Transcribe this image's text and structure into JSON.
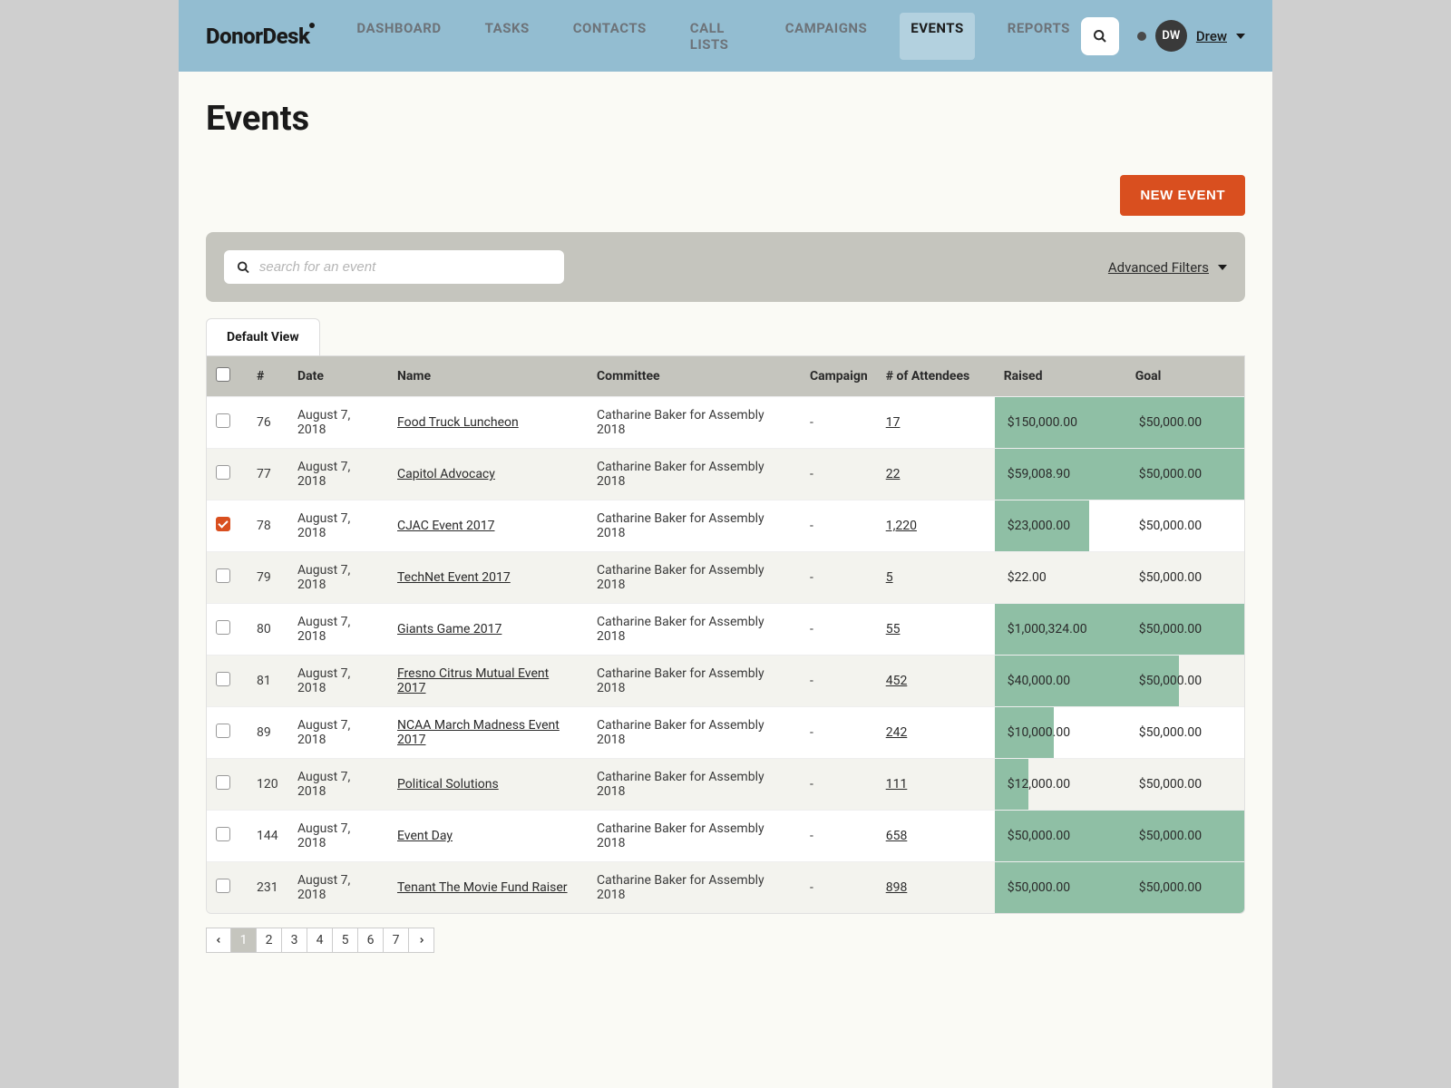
{
  "brand": "DonorDesk",
  "nav": {
    "items": [
      "DASHBOARD",
      "TASKS",
      "CONTACTS",
      "CALL LISTS",
      "CAMPAIGNS",
      "EVENTS",
      "REPORTS"
    ],
    "active": 5
  },
  "user": {
    "initials": "DW",
    "name": "Drew"
  },
  "page": {
    "title": "Events"
  },
  "buttons": {
    "new_event": "NEW EVENT"
  },
  "search": {
    "placeholder": "search for an event"
  },
  "filters": {
    "advanced_label": "Advanced Filters"
  },
  "tabs": {
    "default": "Default View"
  },
  "table": {
    "headers": {
      "num": "#",
      "date": "Date",
      "name": "Name",
      "committee": "Committee",
      "campaign": "Campaign",
      "attendees": "# of Attendees",
      "raised": "Raised",
      "goal": "Goal"
    },
    "rows": [
      {
        "checked": false,
        "num": "76",
        "date": "August 7, 2018",
        "name": "Food Truck Luncheon",
        "committee": "Catharine Baker for Assembly 2018",
        "campaign": "-",
        "attendees": "17",
        "raised": "$150,000.00",
        "raised_pct": 100,
        "goal": "$50,000.00",
        "goal_pct": 100
      },
      {
        "checked": false,
        "num": "77",
        "date": "August 7, 2018",
        "name": "Capitol Advocacy",
        "committee": "Catharine Baker for Assembly 2018",
        "campaign": "-",
        "attendees": "22",
        "raised": "$59,008.90",
        "raised_pct": 100,
        "goal": "$50,000.00",
        "goal_pct": 100
      },
      {
        "checked": true,
        "num": "78",
        "date": "August 7, 2018",
        "name": "CJAC Event 2017",
        "committee": "Catharine Baker for Assembly 2018",
        "campaign": "-",
        "attendees": "1,220",
        "raised": "$23,000.00",
        "raised_pct": 72,
        "goal": "$50,000.00",
        "goal_pct": 0
      },
      {
        "checked": false,
        "num": "79",
        "date": "August 7, 2018",
        "name": "TechNet Event 2017",
        "committee": "Catharine Baker for Assembly 2018",
        "campaign": "-",
        "attendees": "5",
        "raised": "$22.00",
        "raised_pct": 0,
        "goal": "$50,000.00",
        "goal_pct": 0
      },
      {
        "checked": false,
        "num": "80",
        "date": "August 7, 2018",
        "name": "Giants Game 2017",
        "committee": "Catharine Baker for Assembly 2018",
        "campaign": "-",
        "attendees": "55",
        "raised": "$1,000,324.00",
        "raised_pct": 100,
        "goal": "$50,000.00",
        "goal_pct": 100
      },
      {
        "checked": false,
        "num": "81",
        "date": "August 7, 2018",
        "name": "Fresno Citrus Mutual Event 2017",
        "committee": "Catharine Baker for Assembly 2018",
        "campaign": "-",
        "attendees": "452",
        "raised": "$40,000.00",
        "raised_pct": 100,
        "goal": "$50,000.00",
        "goal_pct": 45
      },
      {
        "checked": false,
        "num": "89",
        "date": "August 7, 2018",
        "name": "NCAA March Madness Event 2017",
        "committee": "Catharine Baker for Assembly 2018",
        "campaign": "-",
        "attendees": "242",
        "raised": "$10,000.00",
        "raised_pct": 45,
        "goal": "$50,000.00",
        "goal_pct": 0
      },
      {
        "checked": false,
        "num": "120",
        "date": "August 7, 2018",
        "name": "Political Solutions",
        "committee": "Catharine Baker for Assembly 2018",
        "campaign": "-",
        "attendees": "111",
        "raised": "$12,000.00",
        "raised_pct": 26,
        "goal": "$50,000.00",
        "goal_pct": 0
      },
      {
        "checked": false,
        "num": "144",
        "date": "August 7, 2018",
        "name": "Event Day",
        "committee": "Catharine Baker for Assembly 2018",
        "campaign": "-",
        "attendees": "658",
        "raised": "$50,000.00",
        "raised_pct": 100,
        "goal": "$50,000.00",
        "goal_pct": 100
      },
      {
        "checked": false,
        "num": "231",
        "date": "August 7, 2018",
        "name": "Tenant The Movie Fund Raiser",
        "committee": "Catharine Baker for Assembly 2018",
        "campaign": "-",
        "attendees": "898",
        "raised": "$50,000.00",
        "raised_pct": 100,
        "goal": "$50,000.00",
        "goal_pct": 100
      }
    ]
  },
  "pagination": {
    "pages": [
      "1",
      "2",
      "3",
      "4",
      "5",
      "6",
      "7"
    ],
    "active": 0
  }
}
